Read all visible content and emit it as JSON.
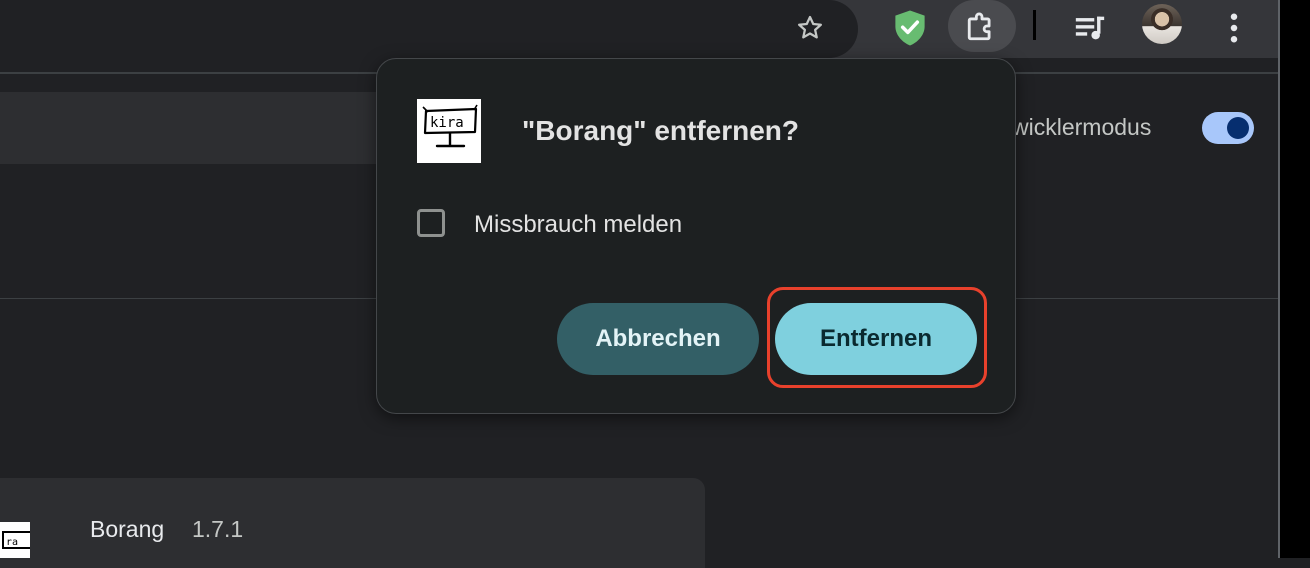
{
  "toolbar": {
    "icons": [
      "bookmark-star-icon",
      "adguard-shield-icon",
      "extensions-puzzle-icon",
      "reading-list-icon",
      "avatar",
      "more-menu-icon"
    ]
  },
  "page": {
    "devmode_label": "wicklermodus",
    "devmode_on": true,
    "extension_card": {
      "name": "Borang",
      "version": "1.7.1"
    }
  },
  "dialog": {
    "logo_text": "kira",
    "title": "\"Borang\" entfernen?",
    "checkbox_label": "Missbrauch melden",
    "checkbox_checked": false,
    "cancel_label": "Abbrechen",
    "confirm_label": "Entfernen"
  },
  "colors": {
    "highlight": "#e8412c",
    "confirm_button": "#7fd0de",
    "cancel_button": "#335f66",
    "toggle": "#a8c7fa"
  }
}
